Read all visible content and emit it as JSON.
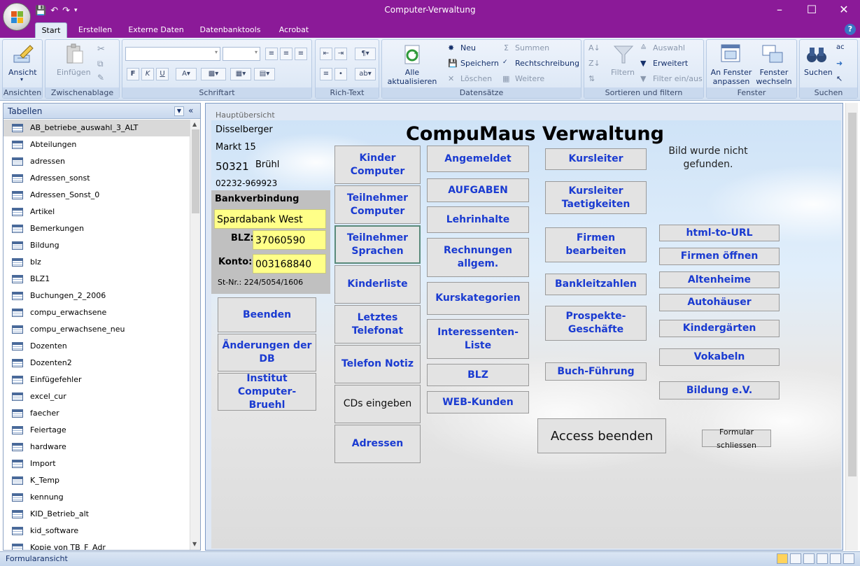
{
  "window": {
    "title": "Computer-Verwaltung"
  },
  "ribbon_tabs": [
    "Start",
    "Erstellen",
    "Externe Daten",
    "Datenbanktools",
    "Acrobat"
  ],
  "ribbon": {
    "ansicht": {
      "label": "Ansicht",
      "group": "Ansichten"
    },
    "zwischenablage": {
      "einfuegen": "Einfügen",
      "group": "Zwischenablage"
    },
    "schriftart": {
      "group": "Schriftart",
      "bold": "F",
      "italic": "K",
      "underline": "U"
    },
    "richtext": {
      "group": "Rich-Text"
    },
    "datensaetze": {
      "group": "Datensätze",
      "aktualisieren": "Alle\naktualisieren",
      "neu": "Neu",
      "speichern": "Speichern",
      "loeschen": "Löschen",
      "summen": "Summen",
      "rechtschreibung": "Rechtschreibung",
      "weitere": "Weitere"
    },
    "sortieren": {
      "group": "Sortieren und filtern",
      "filtern": "Filtern",
      "auswahl": "Auswahl",
      "erweitert": "Erweitert",
      "filter_einaus": "Filter ein/aus"
    },
    "fenster": {
      "group": "Fenster",
      "anpassen": "An Fenster\nanpassen",
      "wechseln": "Fenster\nwechseln"
    },
    "suchen": {
      "group": "Suchen",
      "label": "Suchen"
    }
  },
  "navpane": {
    "title": "Tabellen",
    "items": [
      "AB_betriebe_auswahl_3_ALT",
      "Abteilungen",
      "adressen",
      "Adressen_sonst",
      "Adressen_Sonst_0",
      "Artikel",
      "Bemerkungen",
      "Bildung",
      "blz",
      "BLZ1",
      "Buchungen_2_2006",
      "compu_erwachsene",
      "compu_erwachsene_neu",
      "Dozenten",
      "Dozenten2",
      "Einfügefehler",
      "excel_cur",
      "faecher",
      "Feiertage",
      "hardware",
      "Import",
      "K_Temp",
      "kennung",
      "KID_Betrieb_alt",
      "kid_software",
      "Kopie von TB_F_Adr"
    ]
  },
  "form": {
    "window_title": "Hauptübersicht",
    "main_title": "CompuMaus Verwaltung",
    "image_missing": "Bild wurde nicht gefunden.",
    "address": {
      "name": "Disselberger",
      "street": "Markt 15",
      "zip": "50321",
      "city": "Brühl",
      "phone": "02232-969923"
    },
    "bank": {
      "heading": "Bankverbindung",
      "bank_name": "Spardabank West",
      "blz_label": "BLZ:",
      "blz_value": "37060590",
      "konto_label": "Konto:",
      "konto_value": "003168840",
      "steuer": "St-Nr.: 224/5054/1606"
    },
    "buttons": {
      "beenden": "Beenden",
      "aenderungen": "Änderungen der DB",
      "institut": "Institut Computer-\nBruehl",
      "kinder_computer": "Kinder\nComputer",
      "teilnehmer_computer": "Teilnehmer\nComputer",
      "teilnehmer_sprachen": "Teilnehmer\nSprachen",
      "kinderliste": "Kinderliste",
      "letztes_telefonat": "Letztes\nTelefonat",
      "telefon_notiz": "Telefon Notiz",
      "cds_eingeben": "CDs eingeben",
      "adressen": "Adressen",
      "angemeldet": "Angemeldet",
      "aufgaben": "AUFGABEN",
      "lehrinhalte": "Lehrinhalte",
      "rechnungen": "Rechnungen\nallgem.",
      "kurskategorien": "Kurskategorien",
      "interessenten": "Interessenten-Liste",
      "blz": "BLZ",
      "web_kunden": "WEB-Kunden",
      "kursleiter": "Kursleiter",
      "kursleiter_taetigkeiten": "Kursleiter\nTaetigkeiten",
      "firmen_bearbeiten": "Firmen\nbearbeiten",
      "bankleitzahlen": "Bankleitzahlen",
      "prospekte": "Prospekte-\nGeschäfte",
      "buchfuehrung": "Buch-Führung",
      "html_to_url": "html-to-URL",
      "firmen_oeffnen": "Firmen öffnen",
      "altenheime": "Altenheime",
      "autohaeuser": "Autohäuser",
      "kindergaerten": "Kindergärten",
      "vokabeln": "Vokabeln",
      "bildung": "Bildung e.V.",
      "access_beenden": "Access beenden",
      "formular_schliessen": "Formular schliessen"
    }
  },
  "statusbar": {
    "text": "Formularansicht"
  },
  "colors": {
    "titlebar": "#8b1a98",
    "button_text": "#1a3bd1",
    "highlight_field": "#ffff88"
  }
}
